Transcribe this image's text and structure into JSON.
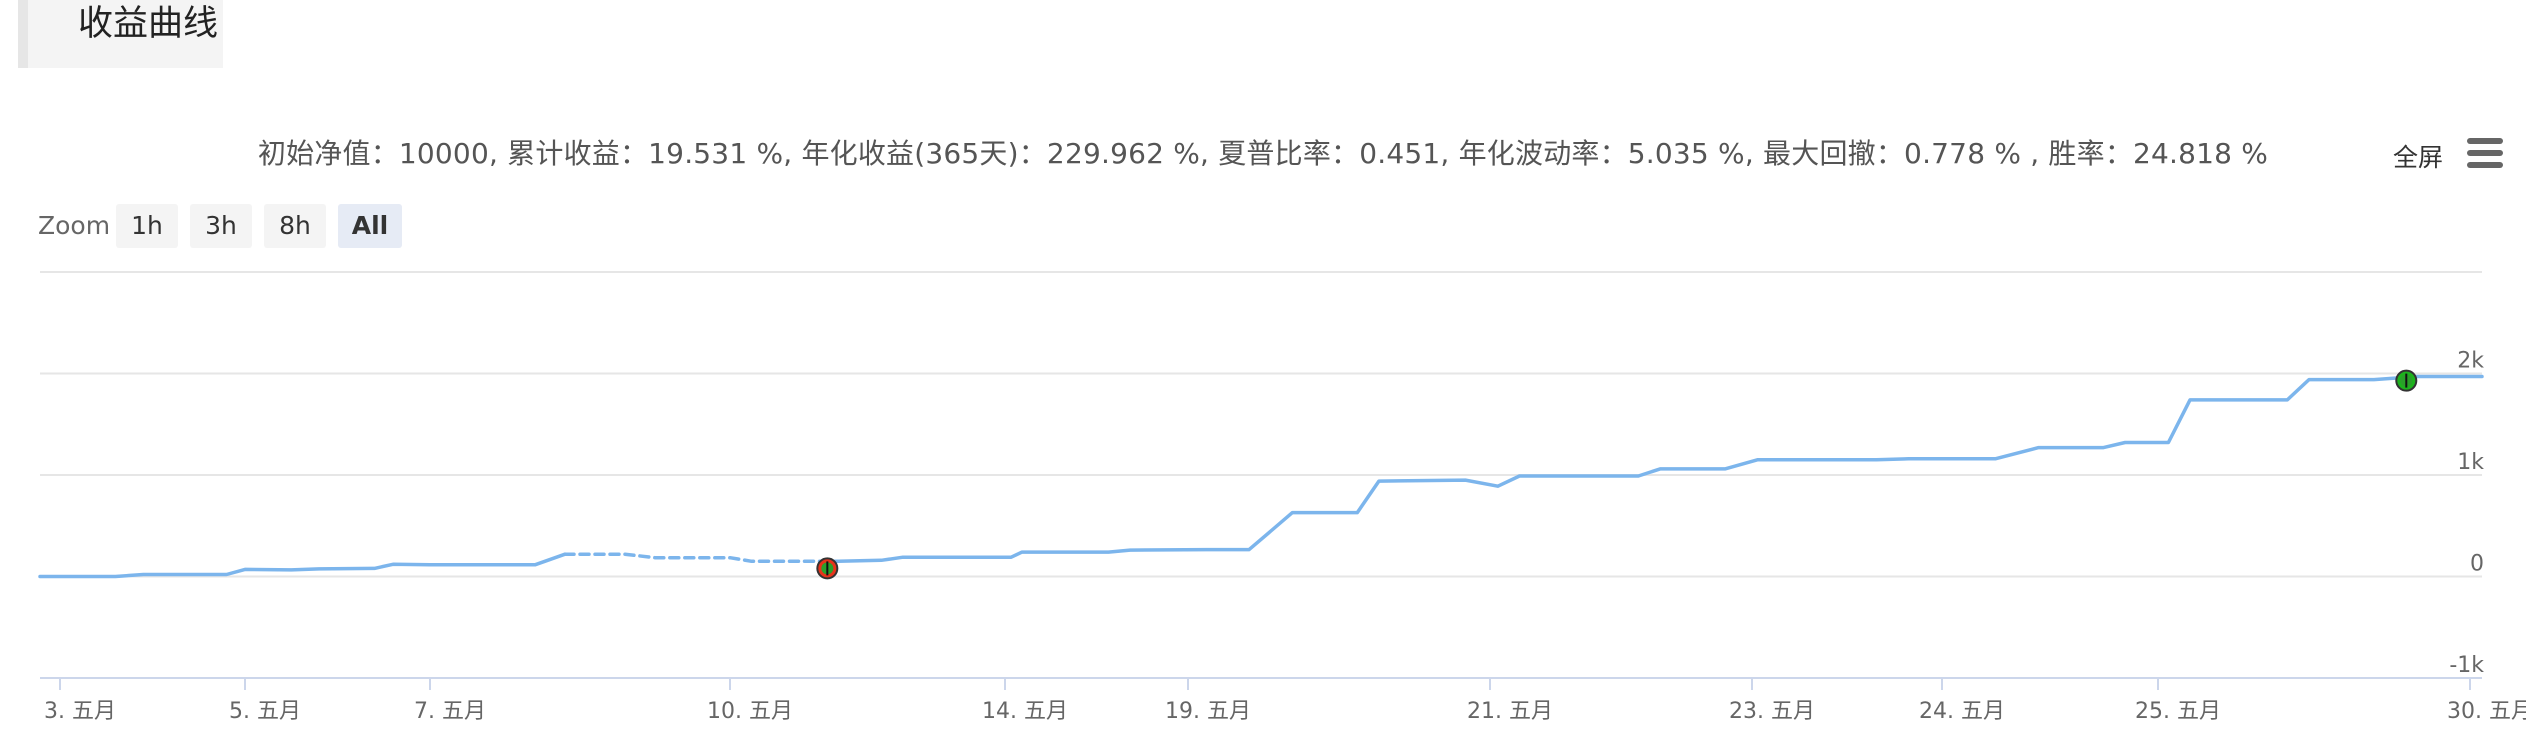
{
  "page": {
    "title": "收益曲线"
  },
  "stats_text": "初始净值：10000, 累计收益：19.531 %, 年化收益(365天)：229.962 %, 夏普比率：0.451, 年化波动率：5.035 %, 最大回撤：0.778 % , 胜率：24.818 %",
  "toolbar": {
    "fullscreen_label": "全屏",
    "menu_icon": "hamburger-menu-icon"
  },
  "zoom": {
    "label": "Zoom",
    "buttons": [
      {
        "label": "1h",
        "active": false
      },
      {
        "label": "3h",
        "active": false
      },
      {
        "label": "8h",
        "active": false
      },
      {
        "label": "All",
        "active": true
      }
    ]
  },
  "chart_data": {
    "type": "line",
    "title": "",
    "xlabel": "",
    "ylabel": "",
    "grid": true,
    "ylim": [
      -1000,
      3000
    ],
    "y_ticks": [
      {
        "value": -1000,
        "label": "-1k"
      },
      {
        "value": 0,
        "label": "0"
      },
      {
        "value": 1000,
        "label": "1k"
      },
      {
        "value": 2000,
        "label": "2k"
      }
    ],
    "x_ticks": [
      {
        "x": 0,
        "label": "3. 五月"
      },
      {
        "x": 1,
        "label": "5. 五月"
      },
      {
        "x": 2,
        "label": "7. 五月"
      },
      {
        "x": 3,
        "label": "10. 五月"
      },
      {
        "x": 4,
        "label": "14. 五月"
      },
      {
        "x": 5,
        "label": "19. 五月"
      },
      {
        "x": 6,
        "label": "21. 五月"
      },
      {
        "x": 7,
        "label": "23. 五月"
      },
      {
        "x": 8,
        "label": "24. 五月"
      },
      {
        "x": 9,
        "label": "25. 五月"
      },
      {
        "x": 10,
        "label": "30. 五月"
      }
    ],
    "xlim": [
      -0.1,
      10.05
    ],
    "color": "#7cb5ec",
    "series": [
      {
        "style": "solid",
        "points": [
          [
            -0.1,
            0
          ],
          [
            0.3,
            0
          ],
          [
            0.45,
            20
          ],
          [
            0.9,
            20
          ],
          [
            1.0,
            70
          ],
          [
            1.25,
            65
          ],
          [
            1.4,
            75
          ],
          [
            1.7,
            80
          ],
          [
            1.8,
            120
          ],
          [
            2.0,
            115
          ],
          [
            2.35,
            115
          ],
          [
            2.45,
            220
          ]
        ]
      },
      {
        "style": "dashed",
        "points": [
          [
            2.45,
            220
          ],
          [
            2.65,
            220
          ],
          [
            2.75,
            185
          ],
          [
            3.0,
            185
          ],
          [
            3.1,
            150
          ],
          [
            3.5,
            150
          ]
        ]
      },
      {
        "style": "solid",
        "points": [
          [
            3.5,
            150
          ],
          [
            3.7,
            160
          ],
          [
            3.8,
            190
          ],
          [
            4.3,
            190
          ],
          [
            4.35,
            240
          ],
          [
            4.75,
            240
          ],
          [
            4.85,
            260
          ],
          [
            5.2,
            265
          ],
          [
            5.4,
            265
          ],
          [
            5.6,
            630
          ],
          [
            5.9,
            630
          ],
          [
            6.0,
            940
          ],
          [
            6.4,
            950
          ],
          [
            6.55,
            890
          ],
          [
            6.65,
            990
          ],
          [
            7.0,
            990
          ],
          [
            7.2,
            990
          ],
          [
            7.3,
            1060
          ],
          [
            7.6,
            1060
          ],
          [
            7.75,
            1150
          ],
          [
            8.3,
            1150
          ],
          [
            8.45,
            1160
          ],
          [
            8.85,
            1160
          ],
          [
            9.05,
            1270
          ],
          [
            9.35,
            1270
          ],
          [
            9.45,
            1320
          ],
          [
            9.65,
            1320
          ],
          [
            9.75,
            1740
          ],
          [
            10.2,
            1740
          ],
          [
            10.3,
            1940
          ],
          [
            10.6,
            1940
          ],
          [
            10.8,
            1970
          ],
          [
            11.1,
            1970
          ]
        ]
      }
    ],
    "markers": [
      {
        "x": 3.45,
        "y": 80,
        "icon": "trade-marker-red",
        "color": "#e8331a"
      },
      {
        "x": 10.75,
        "y": 1930,
        "icon": "trade-marker-green",
        "color": "#1db31d"
      }
    ]
  }
}
